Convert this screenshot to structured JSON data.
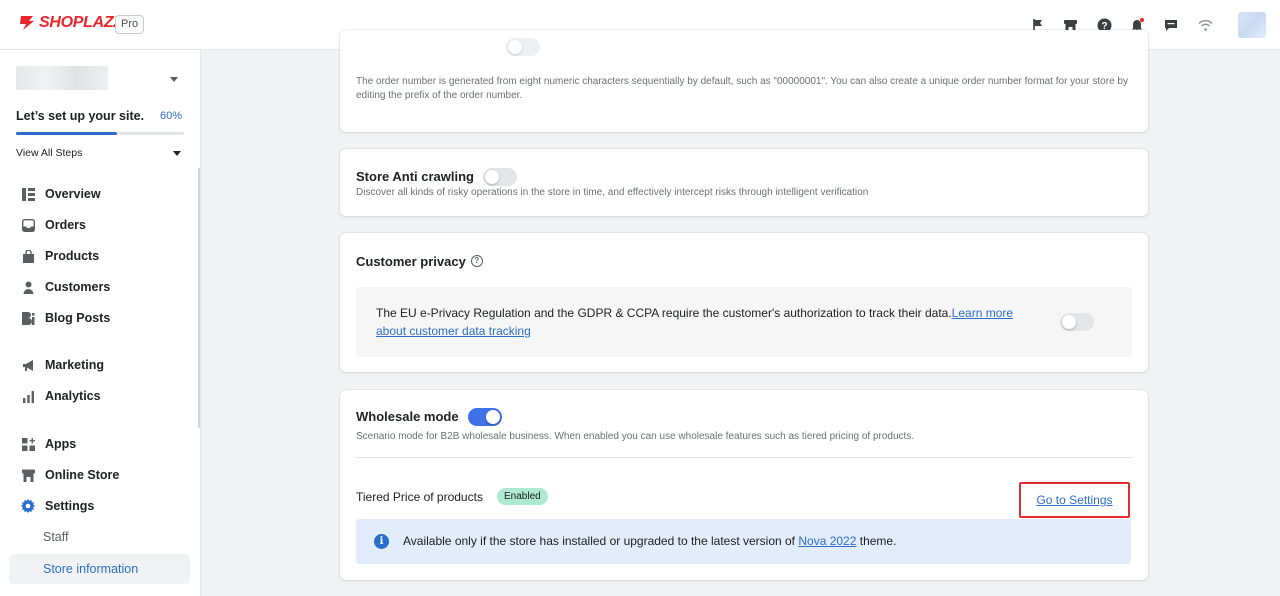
{
  "topbar": {
    "logo_text": "SHOPLAZZA",
    "plan_badge": "Pro",
    "icons": [
      "flag-icon",
      "store-icon",
      "help-icon",
      "bell-icon",
      "chat-icon",
      "wifi-icon"
    ]
  },
  "sidebar": {
    "setup_title": "Let’s set up your site.",
    "setup_percent": "60%",
    "setup_progress": 0.6,
    "view_steps": "View All Steps",
    "items": [
      {
        "label": "Overview",
        "icon": "overview-icon"
      },
      {
        "label": "Orders",
        "icon": "orders-icon"
      },
      {
        "label": "Products",
        "icon": "products-icon"
      },
      {
        "label": "Customers",
        "icon": "customers-icon"
      },
      {
        "label": "Blog Posts",
        "icon": "blog-icon"
      },
      {
        "label": "Marketing",
        "icon": "marketing-icon"
      },
      {
        "label": "Analytics",
        "icon": "analytics-icon"
      },
      {
        "label": "Apps",
        "icon": "apps-icon"
      },
      {
        "label": "Online Store",
        "icon": "online-store-icon"
      },
      {
        "label": "Settings",
        "icon": "settings-icon"
      }
    ],
    "sub_items": [
      {
        "label": "Staff"
      },
      {
        "label": "Store information",
        "active": true
      }
    ]
  },
  "main": {
    "order_number": {
      "description": "The order number is generated from eight numeric characters sequentially by default, such as \"00000001\". You can also create a unique order number format for your store by editing the prefix of the order number."
    },
    "anti_crawling": {
      "title": "Store Anti crawling",
      "description": "Discover all kinds of risky operations in the store in time, and effectively intercept risks through intelligent verification",
      "enabled": false
    },
    "customer_privacy": {
      "title": "Customer privacy",
      "text": "The EU e-Privacy Regulation and the GDPR & CCPA require the customer's authorization to track their data.",
      "link": "Learn more about customer data tracking",
      "enabled": false
    },
    "wholesale": {
      "title": "Wholesale mode",
      "enabled": true,
      "description": "Scenario mode for B2B wholesale business. When enabled you can use wholesale features such as tiered pricing of products.",
      "tier_label": "Tiered Price of products",
      "tier_badge": "Enabled",
      "goto_settings": "Go to Settings",
      "info_prefix": "Available only if the store has installed or upgraded to the latest version of ",
      "info_link": "Nova 2022",
      "info_suffix": " theme."
    }
  },
  "colors": {
    "brand": "#e8262c",
    "accent": "#2c6ecb",
    "toggle_on": "#3f71e8",
    "badge_success": "#aee9d1",
    "highlight_box": "#e02e2e"
  }
}
